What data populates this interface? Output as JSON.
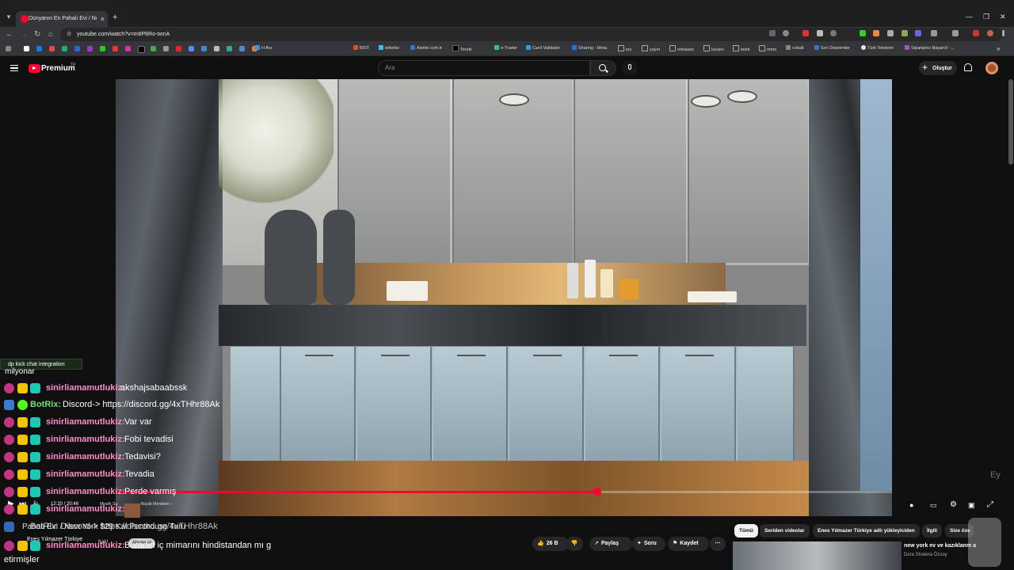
{
  "browser": {
    "tab_title": "Dünyanın En Pahalı Evi / New Y",
    "url": "youtube.com/watch?v=m8P8Ro-txmA",
    "bookmarks": [
      {
        "label": "H Arz",
        "color": "#4a90e2"
      },
      {
        "label": "BIST",
        "color": "#e34c26"
      },
      {
        "label": "letterbx",
        "color": "#40bcf4"
      },
      {
        "label": "Aletler.com.tr",
        "color": "#3d6fd1"
      },
      {
        "label": "Teorik",
        "color": "#000000"
      },
      {
        "label": "e-Trader",
        "color": "#2ecc71"
      },
      {
        "label": "Card Validator",
        "color": "#1da1f2"
      },
      {
        "label": "Sharing - Meta",
        "color": "#1877f2"
      },
      {
        "label": "ios",
        "color": "#777777"
      },
      {
        "label": "yayın",
        "color": "#777777"
      },
      {
        "label": "releases",
        "color": "#777777"
      },
      {
        "label": "issues",
        "color": "#777777"
      },
      {
        "label": "work",
        "color": "#777777"
      },
      {
        "label": "mmo",
        "color": "#777777"
      },
      {
        "label": "cobalt",
        "color": "#777777"
      },
      {
        "label": "Son Depremler",
        "color": "#3d6fd1"
      },
      {
        "label": "Türk Telekom",
        "color": "#e6e6e6"
      },
      {
        "label": "Siparişiniz Başarılı! -...",
        "color": "#9b59b6"
      }
    ]
  },
  "youtube": {
    "brand": "Premium",
    "brand_sup": "TR",
    "search_placeholder": "Ara",
    "create_label": "Oluştur"
  },
  "player": {
    "progress": 0.62,
    "time": "12:20 / 20:46",
    "chapter_label": "Misafir Su",
    "chapter_next": "Büyük Merdiven ›"
  },
  "chat": {
    "integration_label": "dp kick chat integration",
    "cut_message": "milyonar",
    "messages": [
      {
        "user": "sinirliamamutlukiz",
        "text": "akshajsabaabssk",
        "bot": false
      },
      {
        "user": "BotRix",
        "text": "Discord-> https://discord.gg/4xTHhr88Ak",
        "bot": true
      },
      {
        "user": "sinirliamamutlukiz",
        "text": "Var var",
        "bot": false
      },
      {
        "user": "sinirliamamutlukiz",
        "text": "Fobi tevadisi",
        "bot": false
      },
      {
        "user": "sinirliamamutlukiz",
        "text": "Tedavisi?",
        "bot": false
      },
      {
        "user": "sinirliamamutlukiz",
        "text": "Tevadia",
        "bot": false
      },
      {
        "user": "sinirliamamutlukiz",
        "text": "Perde varmış",
        "bot": false
      },
      {
        "user": "sinirliamamutlukiz",
        "text": "",
        "bot": false
      }
    ],
    "overlap_message": "BotRix: Discord-> https://discord.gg/4xTHhr88Ak",
    "last_user": "sinirliamamutlukiz",
    "last_text": "Buranın iç mimarını hindistandan mı g",
    "tail_text": "etirmişler"
  },
  "video_info": {
    "title": "Pahalı Evi / New York $29 Kat Penthouse Turu",
    "channel": "Enes Yılmazer Türkiye",
    "join_label": "Katıl",
    "subscribe_label": "Abone ol",
    "likes": "26 B",
    "share_label": "Paylaş",
    "ask_label": "Soru",
    "save_label": "Kaydet"
  },
  "related": {
    "chips": [
      "Tümü",
      "Seriden videolar",
      "Enes Yılmazer Türkiye adlı yükleyiciden",
      "İlgili",
      "Size öze"
    ],
    "first_title": "new york ev ve kazıklanm a",
    "first_channel": "Dora Stratera Özsoy"
  }
}
